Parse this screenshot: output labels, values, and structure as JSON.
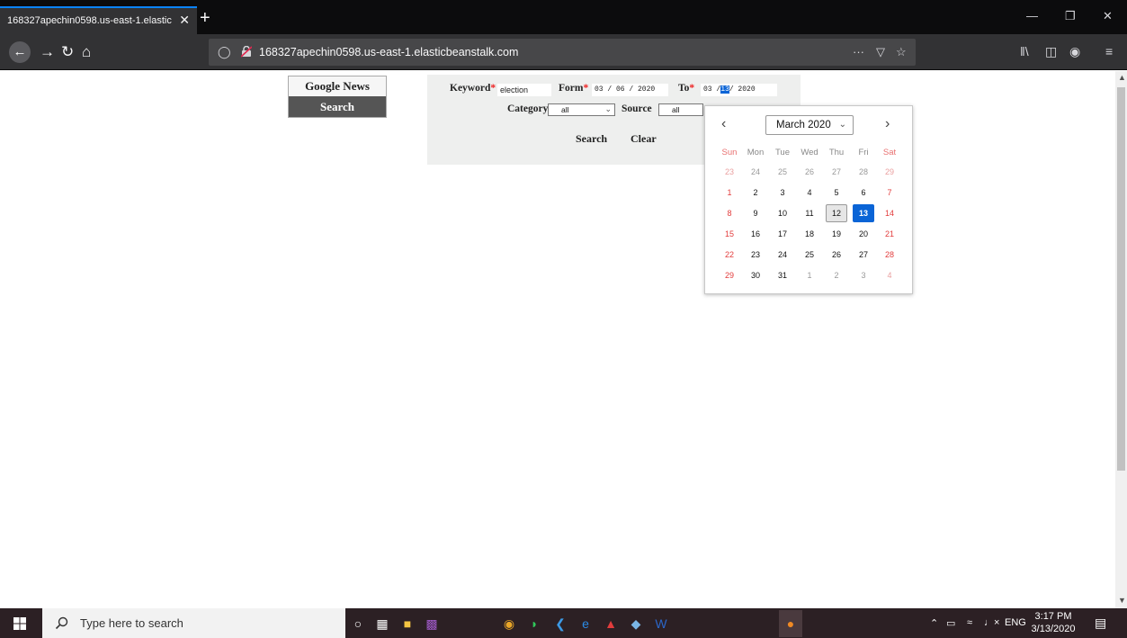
{
  "browser": {
    "tab_title": "168327apechin0598.us-east-1.elastic",
    "tab_close": "✕",
    "new_tab": "+",
    "url": "168327apechin0598.us-east-1.elasticbeanstalk.com",
    "page_actions": "···",
    "minimize": "—",
    "restore": "❐",
    "close": "✕"
  },
  "page": {
    "panel_title": "Google News",
    "panel_search": "Search",
    "form": {
      "keyword_label": "Keyword",
      "keyword_value": "election",
      "form_label": "Form",
      "form_value": "03 / 06 / 2020",
      "to_label": "To",
      "to_value_prefix": "03 /",
      "to_value_day": "13",
      "to_value_suffix": "/ 2020",
      "required_mark": "*",
      "category_label": "Category",
      "category_value": "all",
      "source_label": "Source",
      "source_value": "all",
      "search_button": "Search",
      "clear_button": "Clear"
    }
  },
  "datepicker": {
    "month_label": "March 2020",
    "prev": "‹",
    "next": "›",
    "weekdays": [
      "Sun",
      "Mon",
      "Tue",
      "Wed",
      "Thu",
      "Fri",
      "Sat"
    ],
    "weeks": [
      [
        "23",
        "24",
        "25",
        "26",
        "27",
        "28",
        "29"
      ],
      [
        "1",
        "2",
        "3",
        "4",
        "5",
        "6",
        "7"
      ],
      [
        "8",
        "9",
        "10",
        "11",
        "12",
        "13",
        "14"
      ],
      [
        "15",
        "16",
        "17",
        "18",
        "19",
        "20",
        "21"
      ],
      [
        "22",
        "23",
        "24",
        "25",
        "26",
        "27",
        "28"
      ],
      [
        "29",
        "30",
        "31",
        "1",
        "2",
        "3",
        "4"
      ]
    ],
    "today": "12",
    "selected": "13"
  },
  "taskbar": {
    "search_placeholder": "Type here to search",
    "language": "ENG",
    "time": "3:17 PM",
    "date": "3/13/2020"
  },
  "colors": {
    "accent": "#0a64d6",
    "weekend": "#e23c3c",
    "required": "#e22222"
  }
}
